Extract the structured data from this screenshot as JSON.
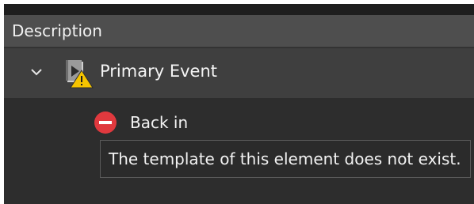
{
  "table": {
    "column_header": "Description"
  },
  "tree": {
    "primary": {
      "label": "Primary Event",
      "icon": "video-warning-icon",
      "expanded": true
    },
    "child": {
      "label": "Back in",
      "icon": "error-icon",
      "status_color": "#e0393e"
    }
  },
  "tooltip": {
    "text": "The template of this element does not exist."
  }
}
